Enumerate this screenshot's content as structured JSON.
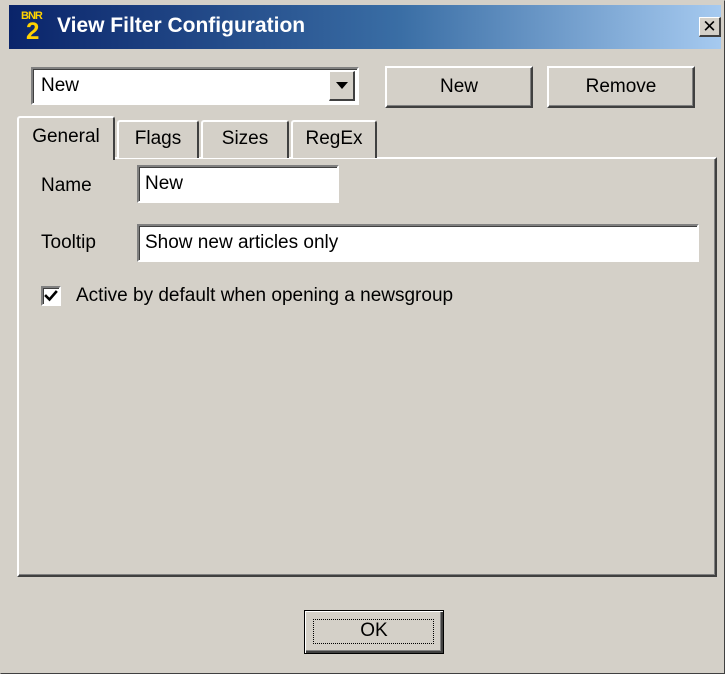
{
  "window": {
    "title": "View Filter Configuration",
    "icon_top": "BNR",
    "icon_num": "2",
    "close_glyph": "✕"
  },
  "filter_select": {
    "selected": "New"
  },
  "toolbar": {
    "new_label": "New",
    "remove_label": "Remove"
  },
  "tabs": [
    {
      "label": "General",
      "active": true
    },
    {
      "label": "Flags",
      "active": false
    },
    {
      "label": "Sizes",
      "active": false
    },
    {
      "label": "RegEx",
      "active": false
    }
  ],
  "general": {
    "name_label": "Name",
    "name_value": "New",
    "tooltip_label": "Tooltip",
    "tooltip_value": "Show new articles only",
    "active_label": "Active by default when opening a newsgroup",
    "active_checked": true
  },
  "footer": {
    "ok_label": "OK"
  },
  "colors": {
    "face": "#d4d0c8",
    "title_start": "#0a246a",
    "title_end": "#a6caf0",
    "icon_yellow": "#ffd200"
  }
}
